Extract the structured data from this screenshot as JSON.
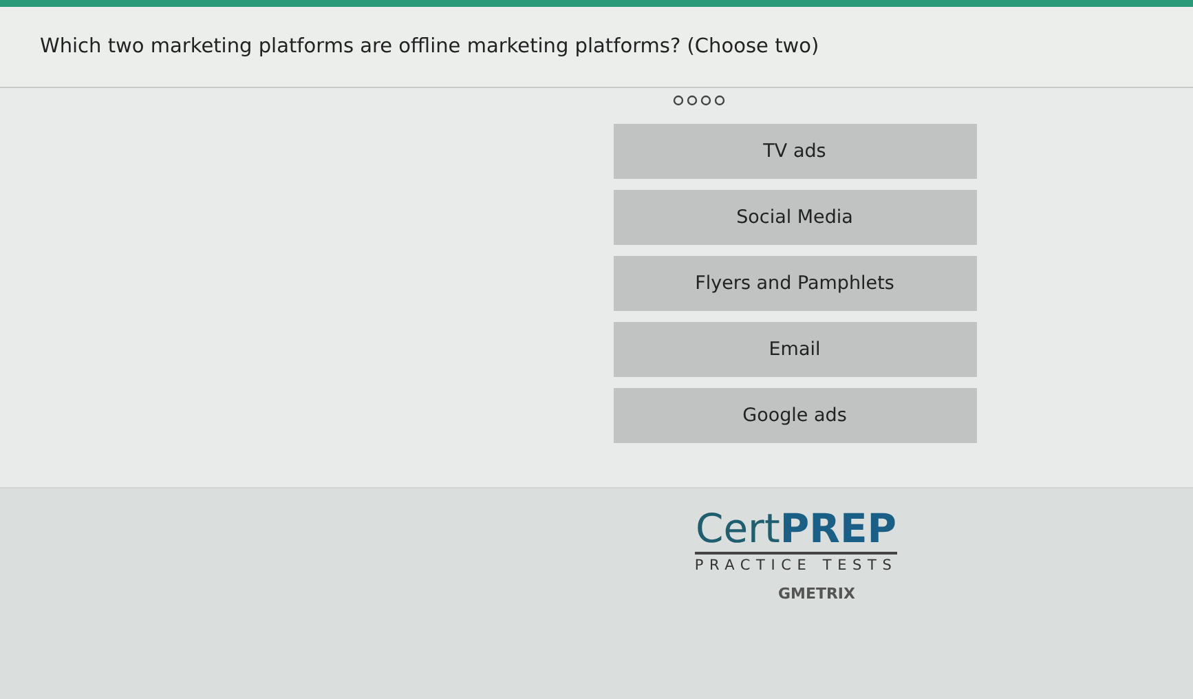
{
  "question": "Which two marketing platforms are offline marketing platforms? (Choose two)",
  "options": [
    {
      "label": "TV ads",
      "selected": false
    },
    {
      "label": "Social Media",
      "selected": false
    },
    {
      "label": "Flyers and Pamphlets",
      "selected": false
    },
    {
      "label": "Email",
      "selected": false
    },
    {
      "label": "Google ads",
      "selected": false
    }
  ],
  "footer": {
    "logo_light": "Cert",
    "logo_bold": "PREP",
    "tagline": "PRACTICE TESTS",
    "brand": "GMETRIX"
  }
}
